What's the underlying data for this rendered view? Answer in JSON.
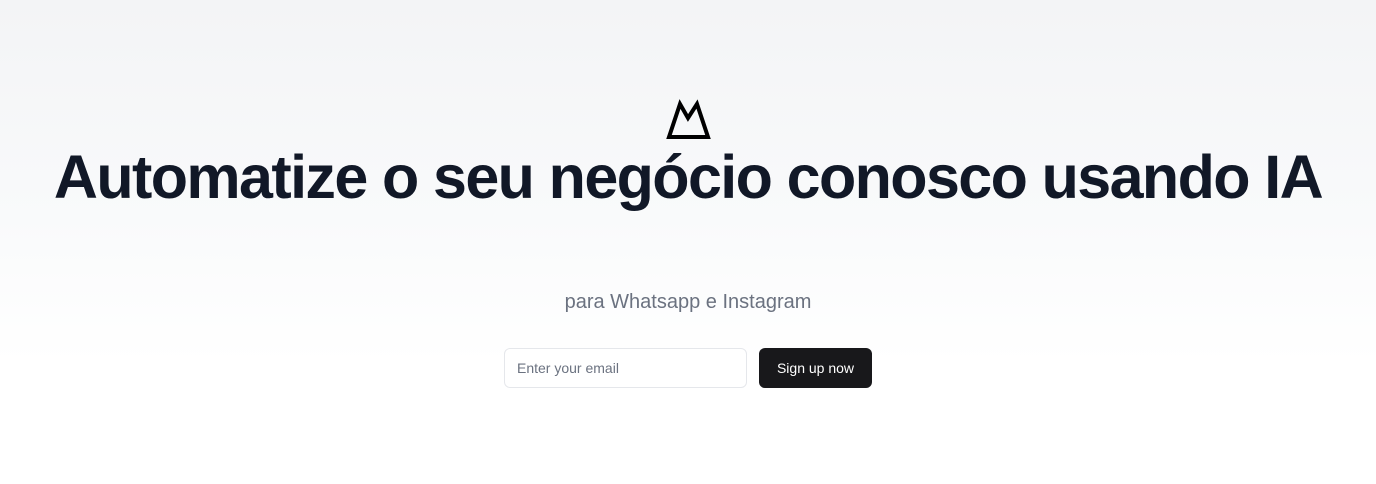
{
  "hero": {
    "logo_icon": "mountain-logo-icon",
    "headline": "Automatize o seu negócio conosco usando IA",
    "subtitle": "para Whatsapp e Instagram"
  },
  "signup_form": {
    "email_placeholder": "Enter your email",
    "email_value": "",
    "button_label": "Sign up now"
  },
  "colors": {
    "heading": "#111827",
    "subtitle": "#6b7280",
    "button_bg": "#18181b",
    "button_text": "#ffffff",
    "input_border": "#e5e7eb"
  }
}
